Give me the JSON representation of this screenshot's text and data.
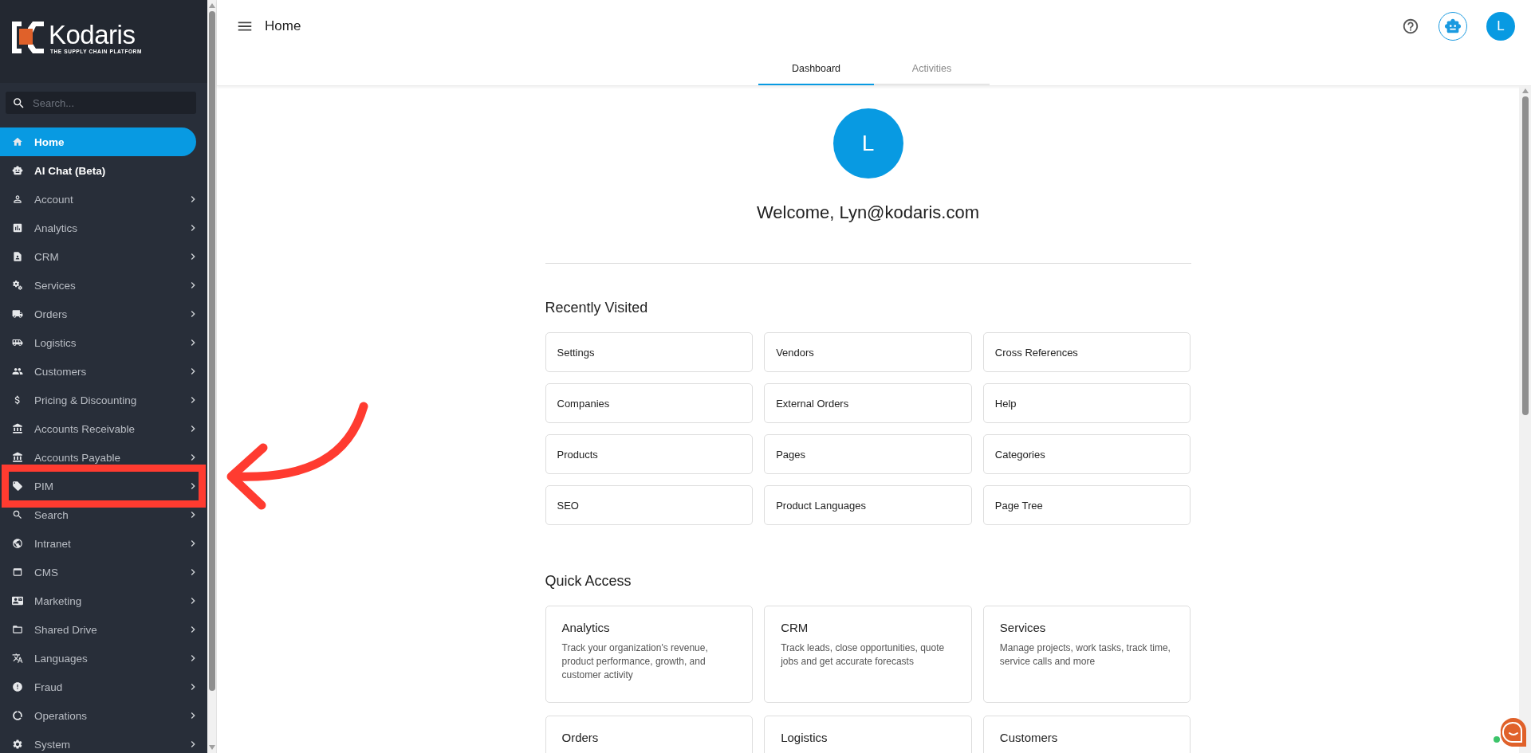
{
  "logo": {
    "name": "Kodaris",
    "tagline": "THE SUPPLY CHAIN PLATFORM"
  },
  "sidebar": {
    "search": {
      "placeholder": "Search..."
    },
    "items": [
      {
        "label": "Home",
        "selected": true,
        "expandable": false,
        "highlighted": false
      },
      {
        "label": "AI Chat (Beta)",
        "selected": false,
        "expandable": false,
        "highlighted": false
      },
      {
        "label": "Account",
        "selected": false,
        "expandable": true,
        "highlighted": false
      },
      {
        "label": "Analytics",
        "selected": false,
        "expandable": true,
        "highlighted": false
      },
      {
        "label": "CRM",
        "selected": false,
        "expandable": true,
        "highlighted": false
      },
      {
        "label": "Services",
        "selected": false,
        "expandable": true,
        "highlighted": false
      },
      {
        "label": "Orders",
        "selected": false,
        "expandable": true,
        "highlighted": false
      },
      {
        "label": "Logistics",
        "selected": false,
        "expandable": true,
        "highlighted": false
      },
      {
        "label": "Customers",
        "selected": false,
        "expandable": true,
        "highlighted": false
      },
      {
        "label": "Pricing & Discounting",
        "selected": false,
        "expandable": true,
        "highlighted": false
      },
      {
        "label": "Accounts Receivable",
        "selected": false,
        "expandable": true,
        "highlighted": false
      },
      {
        "label": "Accounts Payable",
        "selected": false,
        "expandable": true,
        "highlighted": false
      },
      {
        "label": "PIM",
        "selected": false,
        "expandable": true,
        "highlighted": true
      },
      {
        "label": "Search",
        "selected": false,
        "expandable": true,
        "highlighted": false
      },
      {
        "label": "Intranet",
        "selected": false,
        "expandable": true,
        "highlighted": false
      },
      {
        "label": "CMS",
        "selected": false,
        "expandable": true,
        "highlighted": false
      },
      {
        "label": "Marketing",
        "selected": false,
        "expandable": true,
        "highlighted": false
      },
      {
        "label": "Shared Drive",
        "selected": false,
        "expandable": true,
        "highlighted": false
      },
      {
        "label": "Languages",
        "selected": false,
        "expandable": true,
        "highlighted": false
      },
      {
        "label": "Fraud",
        "selected": false,
        "expandable": true,
        "highlighted": false
      },
      {
        "label": "Operations",
        "selected": false,
        "expandable": true,
        "highlighted": false
      },
      {
        "label": "System",
        "selected": false,
        "expandable": true,
        "highlighted": false
      }
    ]
  },
  "header": {
    "title": "Home",
    "avatar": "L"
  },
  "tabs": [
    {
      "label": "Dashboard",
      "selected": true
    },
    {
      "label": "Activities",
      "selected": false
    }
  ],
  "profile": {
    "avatar": "L",
    "welcome": "Welcome, Lyn@kodaris.com"
  },
  "recently_visited": {
    "title": "Recently Visited",
    "items": [
      "Settings",
      "Vendors",
      "Cross References",
      "Companies",
      "External Orders",
      "Help",
      "Products",
      "Pages",
      "Categories",
      "SEO",
      "Product Languages",
      "Page Tree"
    ]
  },
  "quick_access": {
    "title": "Quick Access",
    "items": [
      {
        "title": "Analytics",
        "description": "Track your organization's revenue, product performance, growth, and customer activity"
      },
      {
        "title": "CRM",
        "description": "Track leads, close opportunities, quote jobs and get accurate forecasts"
      },
      {
        "title": "Services",
        "description": "Manage projects, work tasks, track time, service calls and more"
      },
      {
        "title": "Orders"
      },
      {
        "title": "Logistics"
      },
      {
        "title": "Customers"
      }
    ]
  }
}
